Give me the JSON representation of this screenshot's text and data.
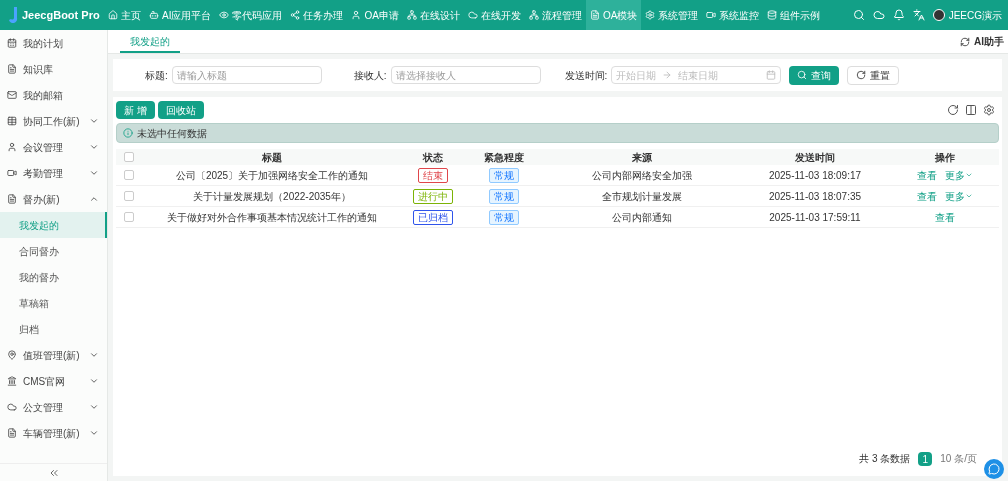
{
  "app": {
    "name": "JeecgBoot Pro"
  },
  "nav": [
    {
      "label": "主页",
      "selected": false
    },
    {
      "label": "AI应用平台",
      "selected": false
    },
    {
      "label": "零代码应用",
      "selected": false
    },
    {
      "label": "任务办理",
      "selected": false
    },
    {
      "label": "OA申请",
      "selected": false
    },
    {
      "label": "在线设计",
      "selected": false
    },
    {
      "label": "在线开发",
      "selected": false
    },
    {
      "label": "流程管理",
      "selected": false
    },
    {
      "label": "OA模块",
      "selected": true
    },
    {
      "label": "系统管理",
      "selected": false
    },
    {
      "label": "系统监控",
      "selected": false
    },
    {
      "label": "组件示例",
      "selected": false
    }
  ],
  "user": {
    "name": "JEECG演示"
  },
  "sidebar": [
    {
      "kind": "item",
      "label": "我的计划"
    },
    {
      "kind": "item",
      "label": "知识库"
    },
    {
      "kind": "item",
      "label": "我的邮箱"
    },
    {
      "kind": "group",
      "label": "协同工作(新)",
      "expanded": false
    },
    {
      "kind": "group",
      "label": "会议管理",
      "expanded": false
    },
    {
      "kind": "group",
      "label": "考勤管理",
      "expanded": false
    },
    {
      "kind": "group",
      "label": "督办(新)",
      "expanded": true,
      "children": [
        {
          "label": "我发起的",
          "selected": true
        },
        {
          "label": "合同督办",
          "selected": false
        },
        {
          "label": "我的督办",
          "selected": false
        },
        {
          "label": "草稿箱",
          "selected": false
        },
        {
          "label": "归档",
          "selected": false
        }
      ]
    },
    {
      "kind": "group",
      "label": "值班管理(新)",
      "expanded": false
    },
    {
      "kind": "group",
      "label": "CMS官网",
      "expanded": false
    },
    {
      "kind": "group",
      "label": "公文管理",
      "expanded": false
    },
    {
      "kind": "group",
      "label": "车辆管理(新)",
      "expanded": false
    }
  ],
  "page_tabs": [
    {
      "label": "我发起的",
      "selected": true
    }
  ],
  "assistant": {
    "label": "AI助手"
  },
  "filters": [
    {
      "label": "标题:",
      "placeholder": "请输入标题"
    },
    {
      "label": "接收人:",
      "placeholder": "请选择接收人"
    }
  ],
  "date_filter": {
    "label": "发送时间:",
    "start_placeholder": "开始日期",
    "end_placeholder": "结束日期"
  },
  "search_buttons": [
    "查询",
    "重置"
  ],
  "toolbar_buttons": [
    "新 增",
    "回收站"
  ],
  "alert": {
    "text": "未选中任何数据"
  },
  "table": {
    "select_all_checked": false,
    "columns": [
      "标题",
      "状态",
      "紧急程度",
      "来源",
      "发送时间",
      "操作"
    ],
    "rows": [
      {
        "checked": false,
        "title": "公司〔2025〕关于加强网络安全工作的通知",
        "status": "结束",
        "color": "#e0464b",
        "urgency": "常规",
        "source": "公司内部网络安全加强",
        "time": "2025-11-03 18:09:17",
        "actions": [
          "查看",
          "更多"
        ]
      },
      {
        "checked": false,
        "title": "关于计量发展规划（2022-2035年）",
        "status": "进行中",
        "color": "#7cb305",
        "urgency": "常规",
        "source": "全市规划计量发展",
        "time": "2025-11-03 18:07:35",
        "actions": [
          "查看",
          "更多"
        ]
      },
      {
        "checked": false,
        "title": "关于做好对外合作事项基本情况统计工作的通知",
        "status": "已归档",
        "color": "#2f54eb",
        "urgency": "常规",
        "source": "公司内部通知",
        "time": "2025-11-03 17:59:11",
        "actions": [
          "查看"
        ]
      }
    ]
  },
  "pagination": {
    "total": "共 3 条数据",
    "pages": [
      {
        "label": "1",
        "selected": true
      }
    ],
    "page_size": "10 条/页"
  }
}
